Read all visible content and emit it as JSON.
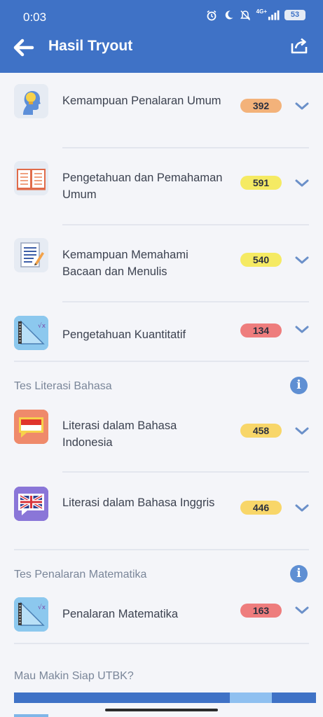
{
  "status_bar": {
    "time": "0:03",
    "network": "4G+",
    "battery": "53"
  },
  "app_bar": {
    "title": "Hasil Tryout"
  },
  "items": [
    {
      "label": "Kemampuan Penalaran Umum",
      "score": "392",
      "score_color": "#f3b27a",
      "icon": "head-idea-icon"
    },
    {
      "label": "Pengetahuan dan Pemahaman Umum",
      "score": "591",
      "score_color": "#f5ea63",
      "icon": "open-book-icon"
    },
    {
      "label": "Kemampuan Memahami Bacaan dan Menulis",
      "score": "540",
      "score_color": "#f5ea63",
      "icon": "document-pencil-icon"
    },
    {
      "label": "Pengetahuan Kuantitatif",
      "score": "134",
      "score_color": "#ee7d7d",
      "icon": "ruler-math-icon"
    },
    {
      "label": "Literasi dalam Bahasa Indonesia",
      "score": "458",
      "score_color": "#f8d669",
      "icon": "indonesia-flag-chat-icon"
    },
    {
      "label": "Literasi dalam Bahasa Inggris",
      "score": "446",
      "score_color": "#f8d669",
      "icon": "uk-flag-chat-icon"
    },
    {
      "label": "Penalaran Matematika",
      "score": "163",
      "score_color": "#ee7d7d",
      "icon": "ruler-math-icon"
    }
  ],
  "sections": [
    {
      "title": "Tes Literasi Bahasa"
    },
    {
      "title": "Tes Penalaran Matematika"
    }
  ],
  "promo": {
    "title": "Mau Makin Siap UTBK?"
  }
}
